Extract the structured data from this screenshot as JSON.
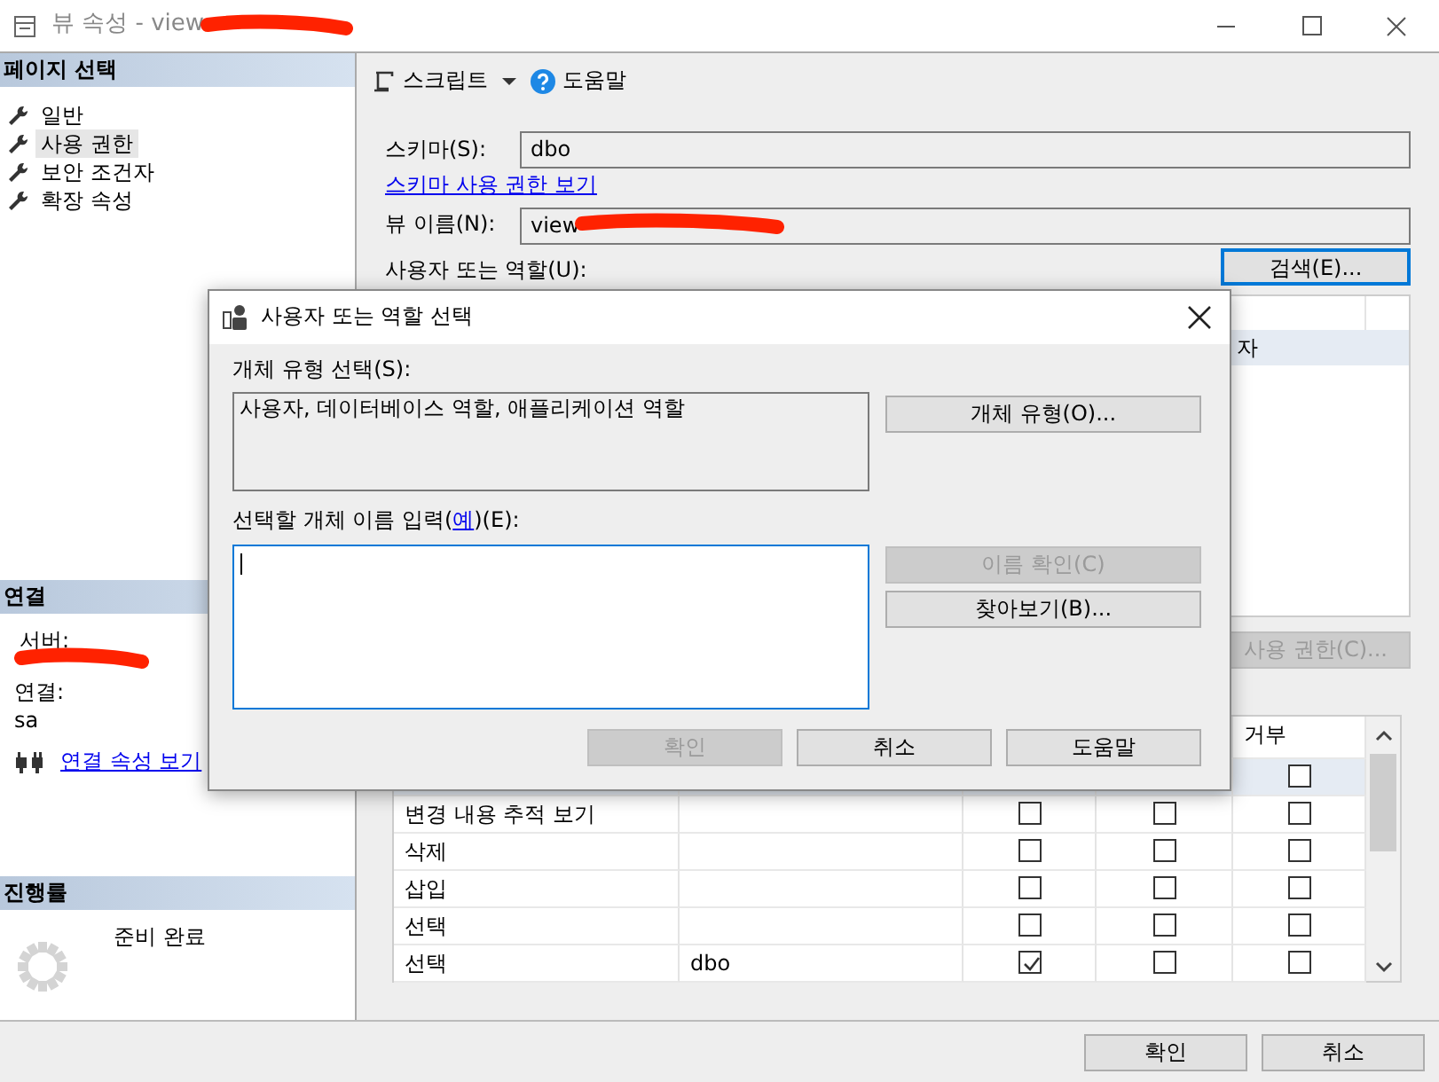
{
  "window": {
    "title": "뷰 속성 - view"
  },
  "sidebar": {
    "page_header": "페이지 선택",
    "pages": [
      {
        "label": "일반",
        "selected": false
      },
      {
        "label": "사용 권한",
        "selected": true
      },
      {
        "label": "보안 조건자",
        "selected": false
      },
      {
        "label": "확장 속성",
        "selected": false
      }
    ],
    "connection": {
      "header": "연결",
      "server_label": "서버:",
      "connection_label": "연결:",
      "connection_value": "sa",
      "link": "연결 속성 보기"
    },
    "progress": {
      "header": "진행률",
      "status": "준비 완료"
    }
  },
  "toolbar": {
    "script": "스크립트",
    "help": "도움말"
  },
  "form": {
    "schema_label": "스키마(S):",
    "schema_value": "dbo",
    "schema_link": "스키마 사용 권한 보기",
    "view_label": "뷰 이름(N):",
    "view_value": "view",
    "users_label": "사용자 또는 역할(U):",
    "search_button": "검색(E)...",
    "users_rows": [
      {
        "type": "자",
        "selected": true
      }
    ],
    "permissions_button": {
      "label": "사용 권한(C)...",
      "disabled": true
    }
  },
  "permissions": {
    "deny_header": "거부",
    "rows": [
      {
        "deny": false,
        "selected": true
      },
      {
        "permission": "변경 내용 추적 보기",
        "grant": false,
        "with_grant": false,
        "deny": false,
        "selected": false
      },
      {
        "permission": "삭제",
        "grant": false,
        "with_grant": false,
        "deny": false,
        "selected": false
      },
      {
        "permission": "삽입",
        "grant": false,
        "with_grant": false,
        "deny": false,
        "selected": false
      },
      {
        "permission": "선택",
        "grant": false,
        "with_grant": false,
        "deny": false,
        "selected": false
      },
      {
        "permission": "선택",
        "grantor": "dbo",
        "grant": true,
        "with_grant": false,
        "deny": false,
        "selected": false
      }
    ]
  },
  "dialog": {
    "title": "사용자 또는 역할 선택",
    "type_label": "개체 유형 선택(S):",
    "types_value": "사용자, 데이터베이스 역할, 애플리케이션 역할",
    "types_button": "개체 유형(O)...",
    "names_label_before": "선택할 개체 이름 입력(",
    "names_link": "예",
    "names_label_after": ")(E):",
    "side_buttons": [
      {
        "label": "이름 확인(C)",
        "disabled": true
      },
      {
        "label": "찾아보기(B)...",
        "disabled": false
      }
    ],
    "buttons": [
      {
        "label": "확인",
        "disabled": true
      },
      {
        "label": "취소",
        "disabled": false
      },
      {
        "label": "도움말",
        "disabled": false
      }
    ]
  },
  "footer_buttons": [
    {
      "label": "확인",
      "disabled": false
    },
    {
      "label": "취소",
      "disabled": false
    }
  ]
}
